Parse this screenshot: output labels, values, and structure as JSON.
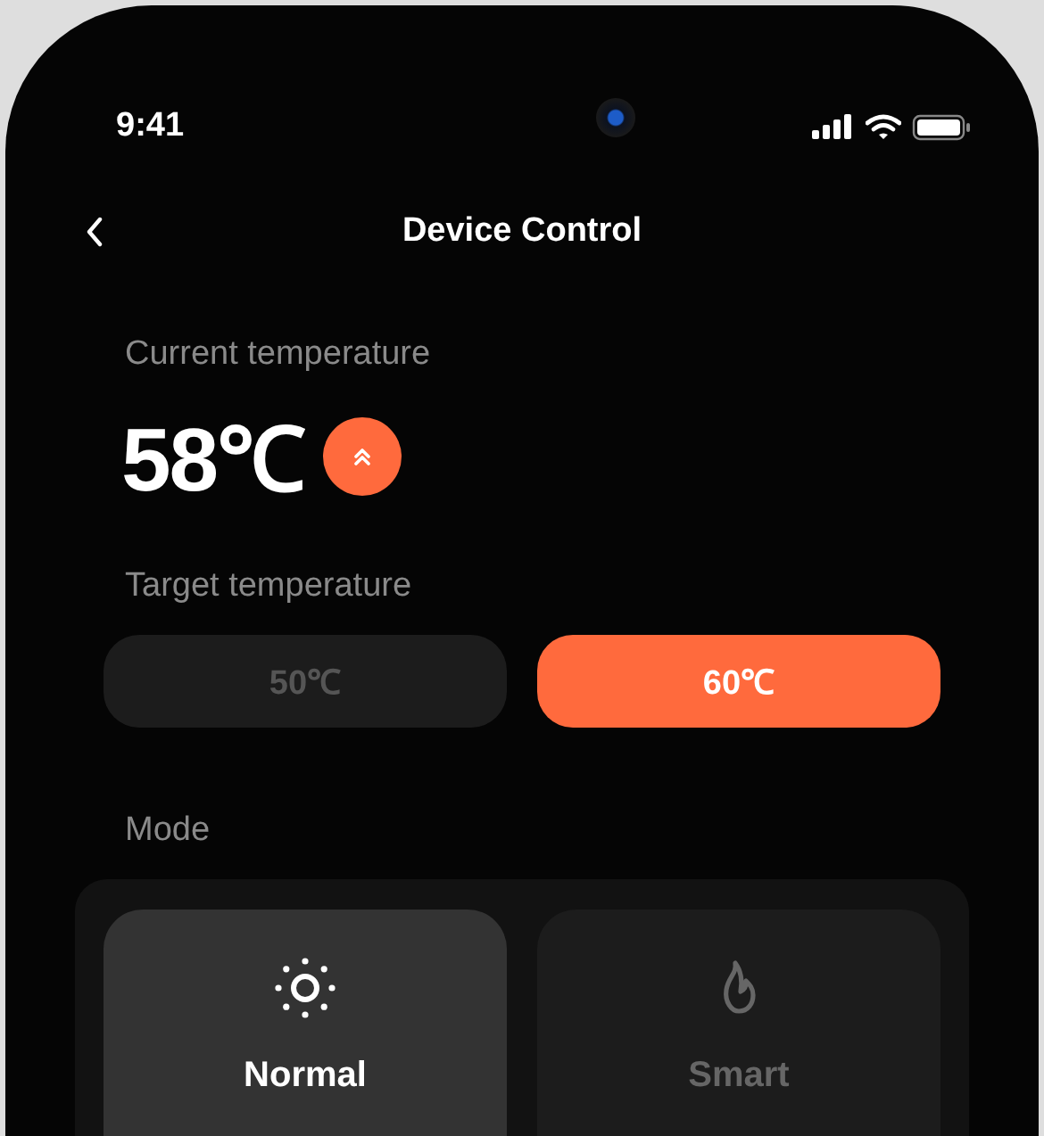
{
  "status_bar": {
    "time": "9:41"
  },
  "header": {
    "title": "Device Control"
  },
  "current": {
    "label": "Current temperature",
    "value": "58℃",
    "rising": true
  },
  "target": {
    "label": "Target temperature",
    "options": [
      {
        "label": "50℃",
        "selected": false
      },
      {
        "label": "60℃",
        "selected": true
      }
    ]
  },
  "mode": {
    "label": "Mode",
    "options": [
      {
        "label": "Normal",
        "kind": "sun",
        "selected": true
      },
      {
        "label": "Smart",
        "kind": "flame",
        "selected": false
      }
    ]
  }
}
